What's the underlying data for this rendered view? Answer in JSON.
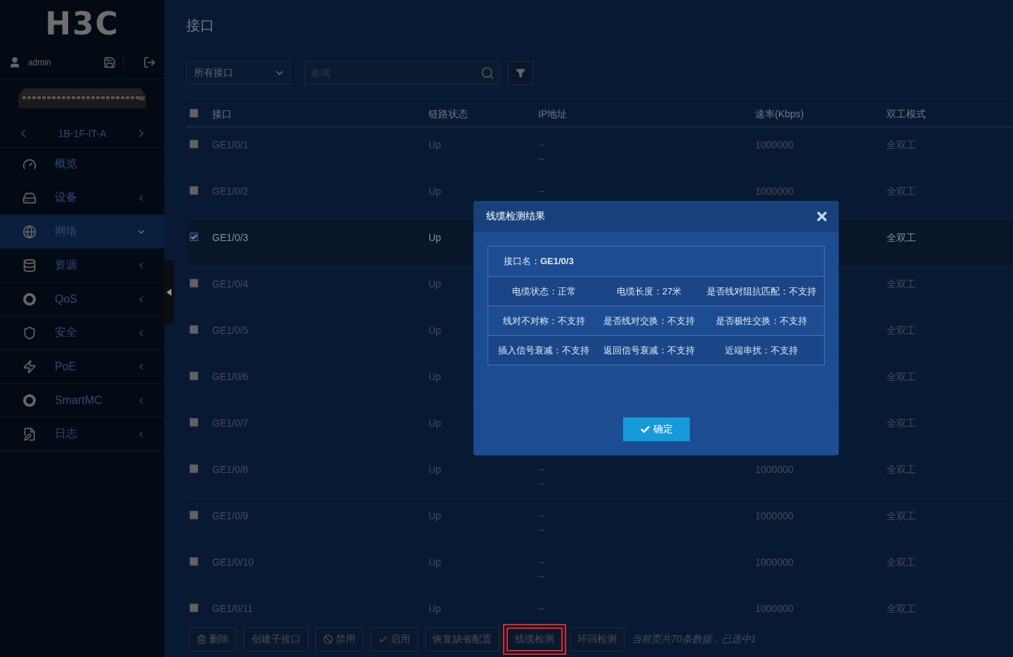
{
  "sidebar": {
    "logo": "H3C",
    "user": "admin",
    "device_name": "1B-1F-IT-A",
    "items": [
      {
        "label": "概览",
        "kind": "link",
        "selected": false
      },
      {
        "label": "设备",
        "kind": "group",
        "selected": false,
        "expanded": false
      },
      {
        "label": "网络",
        "kind": "group",
        "selected": true,
        "expanded": true
      },
      {
        "label": "资源",
        "kind": "group",
        "selected": false,
        "expanded": false
      },
      {
        "label": "QoS",
        "kind": "group",
        "selected": false,
        "expanded": false
      },
      {
        "label": "安全",
        "kind": "group",
        "selected": false,
        "expanded": false
      },
      {
        "label": "PoE",
        "kind": "group",
        "selected": false,
        "expanded": false
      },
      {
        "label": "SmartMC",
        "kind": "group",
        "selected": false,
        "expanded": false
      },
      {
        "label": "日志",
        "kind": "group",
        "selected": false,
        "expanded": false
      }
    ]
  },
  "page_title": "接口",
  "toolbar": {
    "filter_select": "所有接口",
    "search": {
      "placeholder": "查询"
    }
  },
  "table": {
    "columns": [
      "接口",
      "链路状态",
      "IP地址",
      "速率(Kbps)",
      "双工模式"
    ],
    "all_checked": false,
    "rows": [
      {
        "interface": "GE1/0/1",
        "status": "Up",
        "ip": [
          "--",
          "--"
        ],
        "speed": "1000000",
        "duplex": "全双工",
        "checked": false
      },
      {
        "interface": "GE1/0/2",
        "status": "Up",
        "ip": [
          "--"
        ],
        "speed": "1000000",
        "duplex": "全双工",
        "checked": false
      },
      {
        "interface": "GE1/0/3",
        "status": "Up",
        "ip": [],
        "duplex": "全双工",
        "checked": true
      },
      {
        "interface": "GE1/0/4",
        "status": "Up",
        "ip": [],
        "duplex": "全双工",
        "checked": false
      },
      {
        "interface": "GE1/0/5",
        "status": "Up",
        "ip": [],
        "duplex": "全双工",
        "checked": false
      },
      {
        "interface": "GE1/0/6",
        "status": "Up",
        "ip": [],
        "duplex": "全双工",
        "checked": false
      },
      {
        "interface": "GE1/0/7",
        "status": "Up",
        "ip": [],
        "duplex": "全双工",
        "checked": false
      },
      {
        "interface": "GE1/0/8",
        "status": "Up",
        "ip": [
          "--",
          "--"
        ],
        "speed": "1000000",
        "duplex": "全双工",
        "checked": false
      },
      {
        "interface": "GE1/0/9",
        "status": "Up",
        "ip": [
          "--",
          "--"
        ],
        "speed": "1000000",
        "duplex": "全双工",
        "checked": false
      },
      {
        "interface": "GE1/0/10",
        "status": "Up",
        "ip": [
          "--",
          "--"
        ],
        "speed": "1000000",
        "duplex": "全双工",
        "checked": false
      },
      {
        "interface": "GE1/0/11",
        "status": "Up",
        "ip": [
          "--"
        ],
        "speed": "1000000",
        "duplex": "全双工",
        "checked": false
      }
    ]
  },
  "footer": {
    "buttons": [
      {
        "label": "删除",
        "highlighted": false
      },
      {
        "label": "创建子接口",
        "highlighted": false
      },
      {
        "label": "禁用",
        "highlighted": false
      },
      {
        "label": "启用",
        "highlighted": false
      },
      {
        "label": "恢复缺省配置",
        "highlighted": false
      },
      {
        "label": "线缆检测",
        "highlighted": true
      },
      {
        "label": "环回检测",
        "highlighted": false
      }
    ],
    "summary": "当前页共70条数据，已选中1"
  },
  "dialog": {
    "title": "线缆检测结果",
    "rows": [
      [
        "接口名：**GE1/0/3**"
      ],
      [
        "电缆状态：正常",
        "电缆长度：27米",
        "是否线对阻抗匹配：不支持"
      ],
      [
        "线对不对称：不支持",
        "是否线对交换：不支持",
        "是否极性交换：不支持"
      ],
      [
        "插入信号衰减：不支持",
        "返回信号衰减：不支持",
        "近端串扰：不支持"
      ]
    ],
    "ok_button": "确定"
  }
}
